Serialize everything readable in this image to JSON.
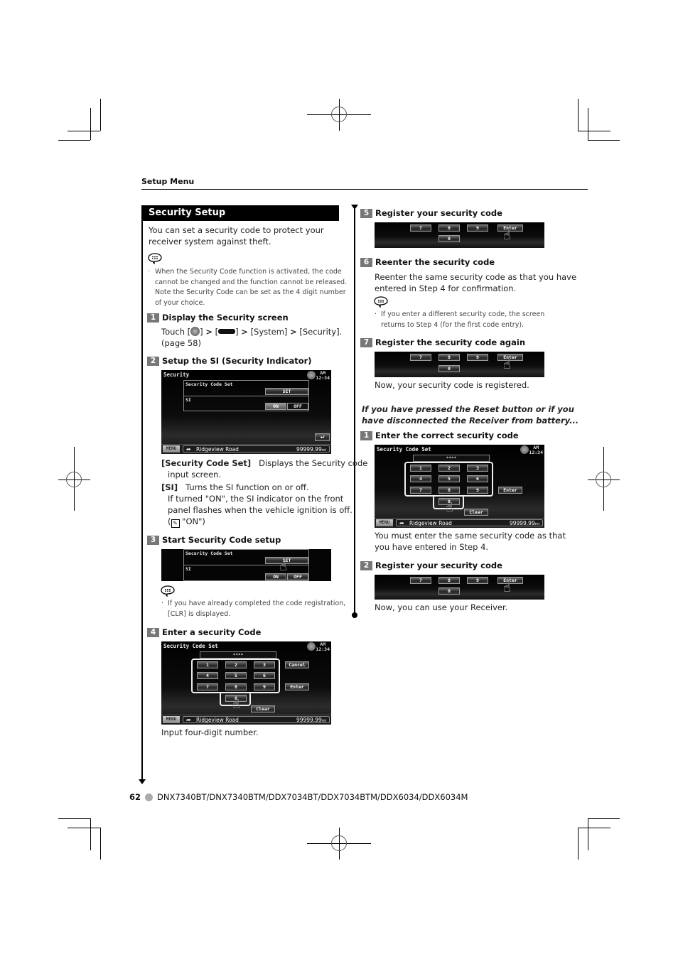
{
  "header": {
    "section": "Setup Menu"
  },
  "title": "Security Setup",
  "intro": [
    "You can set a security code to protect your",
    "receiver system against theft."
  ],
  "intro_note": [
    "When the Security Code function is activated, the code",
    "cannot be changed and the function cannot be released.",
    "Note the Security Code can be set as the 4 digit number",
    "of your choice."
  ],
  "steps_left": [
    {
      "num": "1",
      "title": "Display the Security screen",
      "body": {
        "touch": "Touch [",
        "sep1": "] ",
        "sep2": "] ",
        "system": "[System]",
        "security": "[Security].",
        "page": "(page 58)"
      }
    },
    {
      "num": "2",
      "title": "Setup the SI (Security Indicator)"
    },
    {
      "num": "3",
      "title": "Start Security Code setup"
    },
    {
      "num": "4",
      "title": "Enter a security Code"
    }
  ],
  "step2_desc": {
    "code_set_label": "[Security Code Set]",
    "code_set_text": "Displays the Security code",
    "code_set_text2": "input screen.",
    "si_label": "[SI]",
    "si_text": "Turns the SI function on or off.",
    "si_more": [
      "If turned \"ON\", the SI indicator on the front",
      "panel flashes when the vehicle ignition is off."
    ],
    "si_default": "\"ON\")"
  },
  "step3_note": [
    "If you have already completed the code registration,",
    "[CLR] is displayed."
  ],
  "step4_caption": "Input four-digit number.",
  "screens": {
    "security": {
      "title": "Security",
      "clock_ampm": "AM",
      "clock_time": "12:34",
      "row1_label": "Security Code Set",
      "row1_button": "SET",
      "row2_label": "SI",
      "on_label": "ON",
      "off_label": "OFF"
    },
    "code_set": {
      "title": "Security Code Set",
      "password_mask": "****",
      "keys": [
        "1",
        "2",
        "3",
        "4",
        "5",
        "6",
        "7",
        "8",
        "9",
        "0"
      ],
      "cancel": "Cancel",
      "enter": "Enter",
      "clear": "Clear"
    },
    "status": {
      "menu": "MENU",
      "road": "Ridgeview Road",
      "distance": "99999.99",
      "unit": "mi"
    }
  },
  "steps_right": [
    {
      "num": "5",
      "title": "Register your security code"
    },
    {
      "num": "6",
      "title": "Reenter the security code",
      "body": [
        "Reenter the same security code as that you have",
        "entered in Step 4 for confirmation."
      ],
      "note": [
        "If you enter a different security code, the screen",
        "returns to Step 4 (for the first code entry)."
      ]
    },
    {
      "num": "7",
      "title": "Register the security code again",
      "caption": "Now, your security code is registered."
    }
  ],
  "reset_heading": [
    "If you have pressed the Reset button or if you",
    "have disconnected the Receiver from battery..."
  ],
  "reset_steps": [
    {
      "num": "1",
      "title": "Enter the correct security code",
      "caption": [
        "You must enter the same security code as that",
        "you have entered in Step 4."
      ]
    },
    {
      "num": "2",
      "title": "Register your security code",
      "caption": "Now, you can use your Receiver."
    }
  ],
  "footer": {
    "page": "62",
    "models": "DNX7340BT/DNX7340BTM/DDX7034BT/DDX7034BTM/DDX6034/DDX6034M"
  }
}
